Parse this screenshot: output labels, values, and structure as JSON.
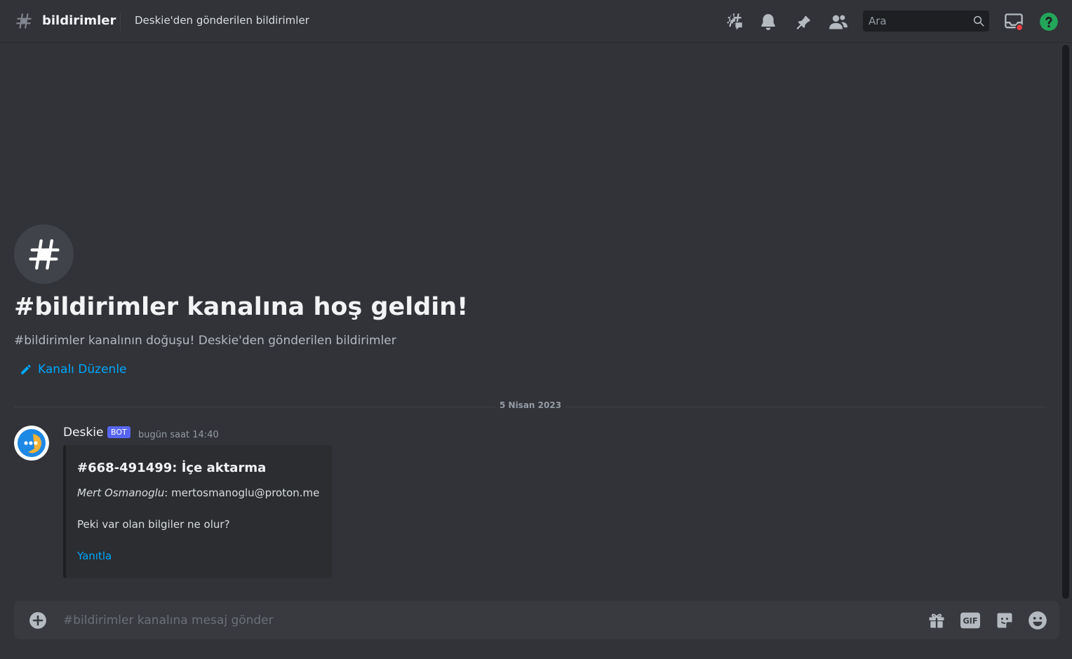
{
  "header": {
    "channel_name": "bildirimler",
    "topic": "Deskie'den gönderilen bildirimler",
    "search_placeholder": "Ara",
    "icons": [
      "threads-icon",
      "bell-icon",
      "pin-icon",
      "members-icon",
      "search-icon",
      "inbox-icon",
      "help-icon"
    ]
  },
  "welcome": {
    "title": "#bildirimler kanalına hoş geldin!",
    "subtitle": "#bildirimler kanalının doğuşu! Deskie'den gönderilen bildirimler",
    "edit_label": "Kanalı Düzenle"
  },
  "date_divider": "5 Nisan 2023",
  "message": {
    "author": "Deskie",
    "bot_tag": "BOT",
    "timestamp": "bugün saat 14:40",
    "embed": {
      "title": "#668-491499: İçe aktarma",
      "sender_name": "Mert Osmanoglu",
      "sender_email": ": mertosmanoglu@proton.me",
      "body": "Peki var olan bilgiler ne olur?",
      "reply_label": "Yanıtla"
    }
  },
  "composer": {
    "placeholder": "#bildirimler kanalına mesaj gönder",
    "gif_label": "GIF"
  },
  "colors": {
    "background": "#313338",
    "link": "#00a8fc",
    "bot_tag": "#5865f2",
    "help": "#23a55a",
    "alert": "#f23f43"
  }
}
